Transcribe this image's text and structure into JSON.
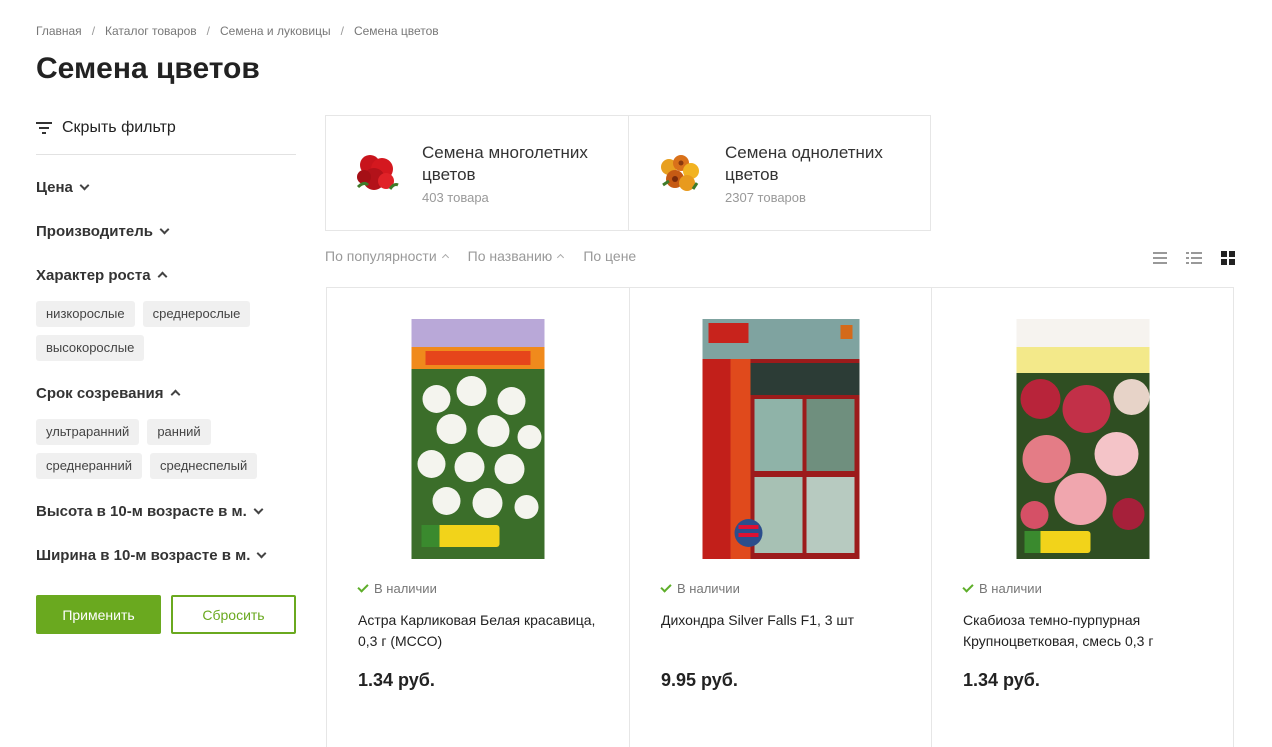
{
  "breadcrumb": [
    "Главная",
    "Каталог товаров",
    "Семена и луковицы",
    "Семена цветов"
  ],
  "page_title": "Семена цветов",
  "sidebar": {
    "toggle_label": "Скрыть фильтр",
    "filters": [
      {
        "label": "Цена",
        "expanded": false,
        "options": []
      },
      {
        "label": "Производитель",
        "expanded": false,
        "options": []
      },
      {
        "label": "Характер роста",
        "expanded": true,
        "options": [
          "низкорослые",
          "среднерослые",
          "высокорослые"
        ]
      },
      {
        "label": "Срок созревания",
        "expanded": true,
        "options": [
          "ультраранний",
          "ранний",
          "среднеранний",
          "среднеспелый"
        ]
      },
      {
        "label": "Высота в 10-м возрасте в м.",
        "expanded": false,
        "options": []
      },
      {
        "label": "Ширина в 10-м возрасте в м.",
        "expanded": false,
        "options": []
      }
    ],
    "apply_label": "Применить",
    "reset_label": "Сбросить"
  },
  "categories": [
    {
      "name": "Семена многолетних цветов",
      "count": "403 товара",
      "icon": "red-flower-icon"
    },
    {
      "name": "Семена однолетних цветов",
      "count": "2307 товаров",
      "icon": "orange-flower-icon"
    }
  ],
  "sort": [
    "По популярности",
    "По названию",
    "По цене"
  ],
  "products": [
    {
      "stock": "В наличии",
      "name": "Астра Карликовая Белая красавица, 0,3 г (МССО)",
      "price": "1.34 руб."
    },
    {
      "stock": "В наличии",
      "name": "Дихондра Silver Falls F1, 3 шт",
      "price": "9.95 руб."
    },
    {
      "stock": "В наличии",
      "name": "Скабиоза темно-пурпурная Крупноцветковая, смесь 0,3 г",
      "price": "1.34 руб."
    }
  ],
  "colors": {
    "accent": "#6aa91f",
    "in_stock": "#5eae2a"
  }
}
